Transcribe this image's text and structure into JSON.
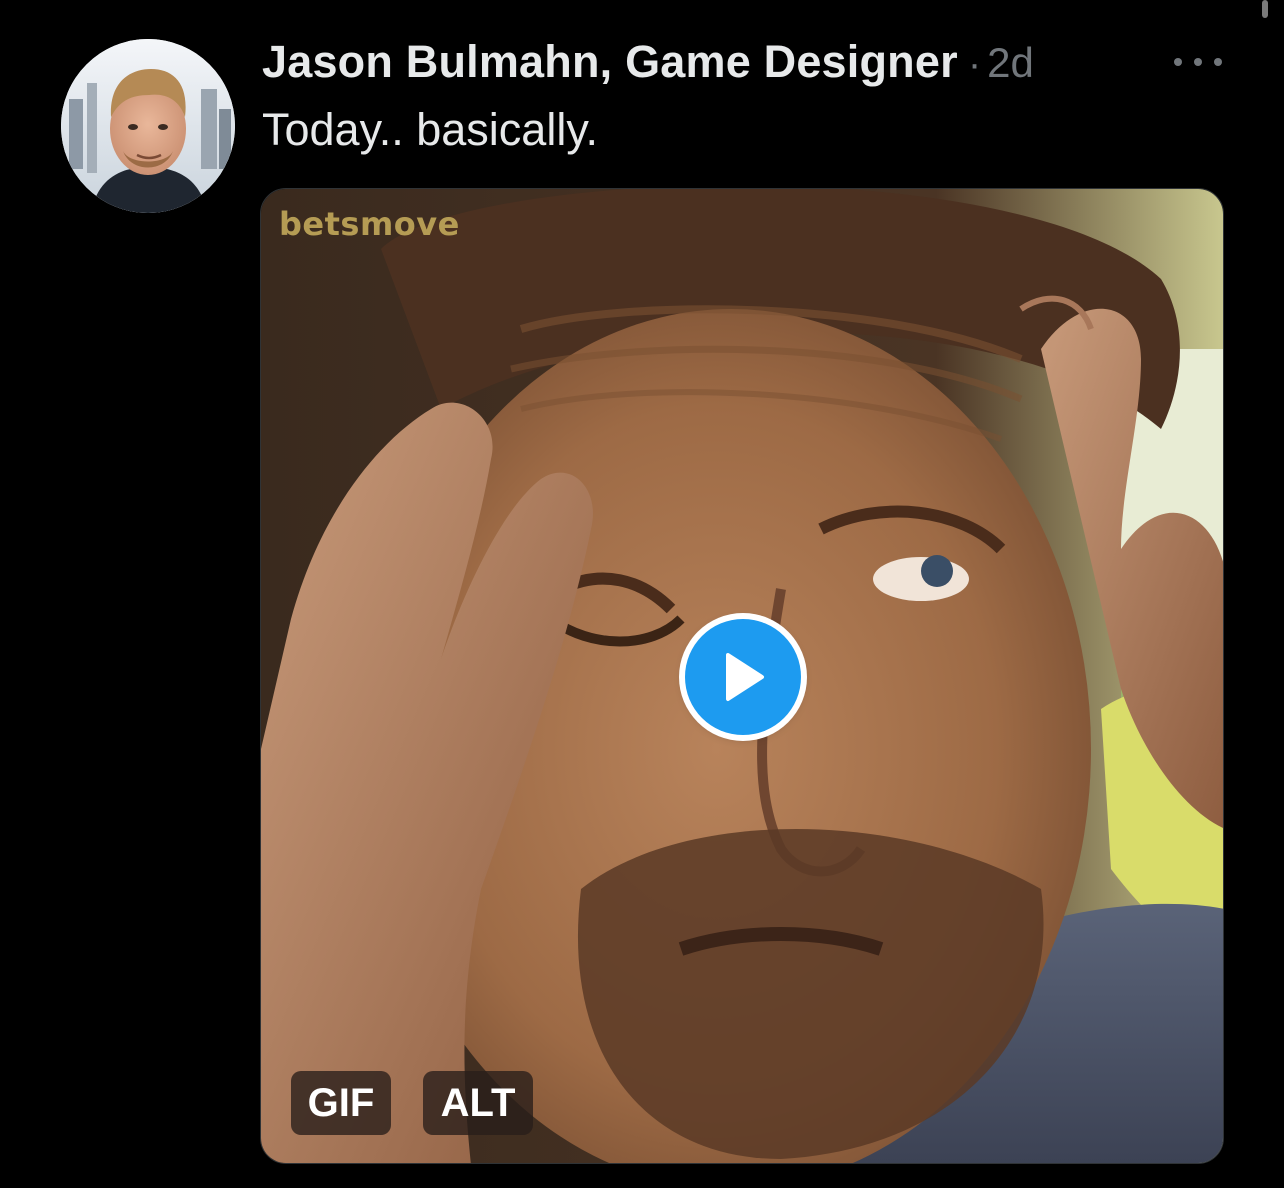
{
  "post": {
    "author": "Jason Bulmahn, Game Designer",
    "separator": "·",
    "timestamp": "2d",
    "text": "Today.. basically."
  },
  "media": {
    "watermark": "betsmove",
    "gif_badge": "GIF",
    "alt_badge": "ALT"
  },
  "icons": {
    "more": "more-horizontal-icon",
    "play": "play-icon"
  },
  "colors": {
    "background": "#000000",
    "primary_text": "#e7e9ea",
    "secondary_text": "#71767b",
    "accent": "#1d9bf0"
  }
}
